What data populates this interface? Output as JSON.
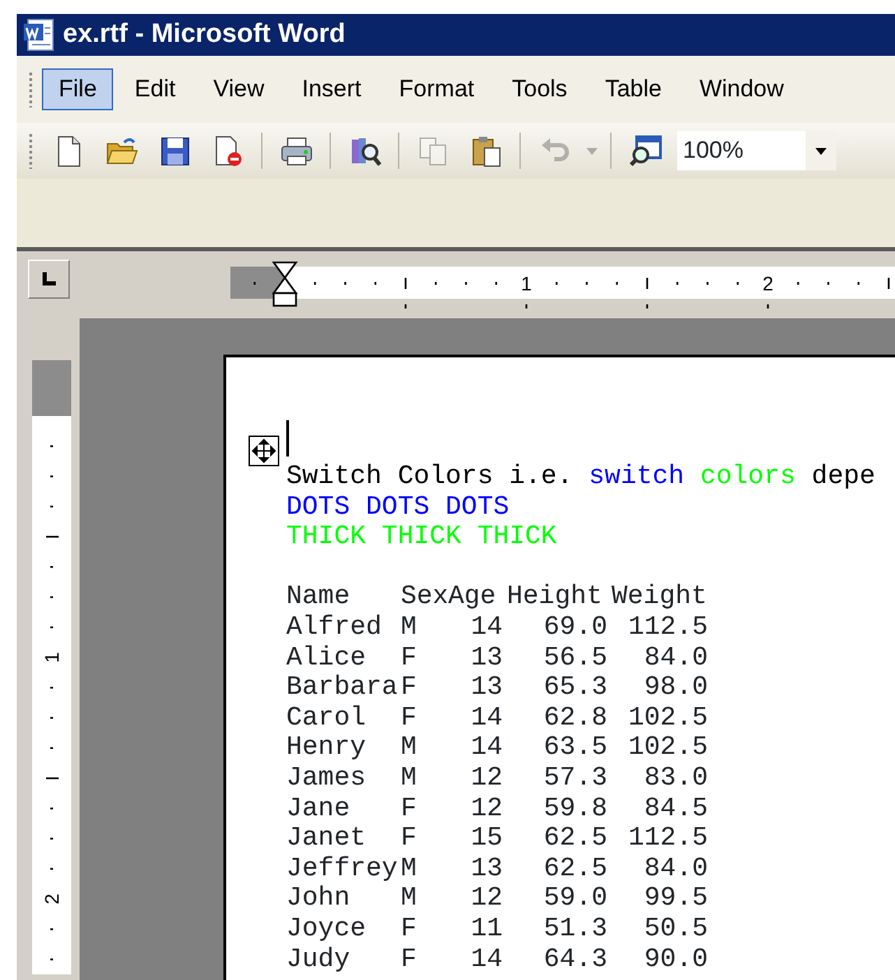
{
  "window": {
    "title": "ex.rtf - Microsoft Word"
  },
  "menu": [
    {
      "label": "File",
      "selected": true
    },
    {
      "label": "Edit",
      "selected": false
    },
    {
      "label": "View",
      "selected": false
    },
    {
      "label": "Insert",
      "selected": false
    },
    {
      "label": "Format",
      "selected": false
    },
    {
      "label": "Tools",
      "selected": false
    },
    {
      "label": "Table",
      "selected": false
    },
    {
      "label": "Window",
      "selected": false
    }
  ],
  "toolbar": {
    "groups": [
      [
        {
          "disabled": false
        },
        {
          "disabled": false
        },
        {
          "disabled": false
        },
        {
          "disabled": false
        }
      ],
      [
        {
          "disabled": false
        }
      ],
      [
        {
          "disabled": false
        }
      ],
      [
        {
          "disabled": true
        },
        {
          "disabled": false
        }
      ],
      [
        {
          "disabled": true
        }
      ],
      [
        {
          "disabled": false
        }
      ]
    ],
    "zoom": {
      "value": "100%"
    }
  },
  "ruler": {
    "numbers": [
      "1",
      "2"
    ]
  },
  "vertical_ruler": {
    "numbers": [
      "1",
      "2"
    ]
  },
  "document": {
    "lines": [
      [
        {
          "text": "Switch Colors i.e.",
          "color": "#000000"
        },
        {
          "text": "switch",
          "color": "#0000ff"
        },
        {
          "text": "colors",
          "color": "#00ff00"
        },
        {
          "text": "depe",
          "color": "#000000"
        }
      ],
      [
        {
          "text": "DOTS DOTS DOTS",
          "color": "#0000ff"
        }
      ],
      [
        {
          "text": "THICK THICK THICK",
          "color": "#00ff00"
        }
      ]
    ],
    "table": {
      "columns": [
        "Name",
        "Sex",
        "Age",
        "Height",
        "Weight"
      ],
      "rows": [
        [
          "Alfred",
          "M",
          "14",
          "69.0",
          "112.5"
        ],
        [
          "Alice",
          "F",
          "13",
          "56.5",
          "84.0"
        ],
        [
          "Barbara",
          "F",
          "13",
          "65.3",
          "98.0"
        ],
        [
          "Carol",
          "F",
          "14",
          "62.8",
          "102.5"
        ],
        [
          "Henry",
          "M",
          "14",
          "63.5",
          "102.5"
        ],
        [
          "James",
          "M",
          "12",
          "57.3",
          "83.0"
        ],
        [
          "Jane",
          "F",
          "12",
          "59.8",
          "84.5"
        ],
        [
          "Janet",
          "F",
          "15",
          "62.5",
          "112.5"
        ],
        [
          "Jeffrey",
          "M",
          "13",
          "62.5",
          "84.0"
        ],
        [
          "John",
          "M",
          "12",
          "59.0",
          "99.5"
        ],
        [
          "Joyce",
          "F",
          "11",
          "51.3",
          "50.5"
        ],
        [
          "Judy",
          "F",
          "14",
          "64.3",
          "90.0"
        ]
      ]
    }
  }
}
